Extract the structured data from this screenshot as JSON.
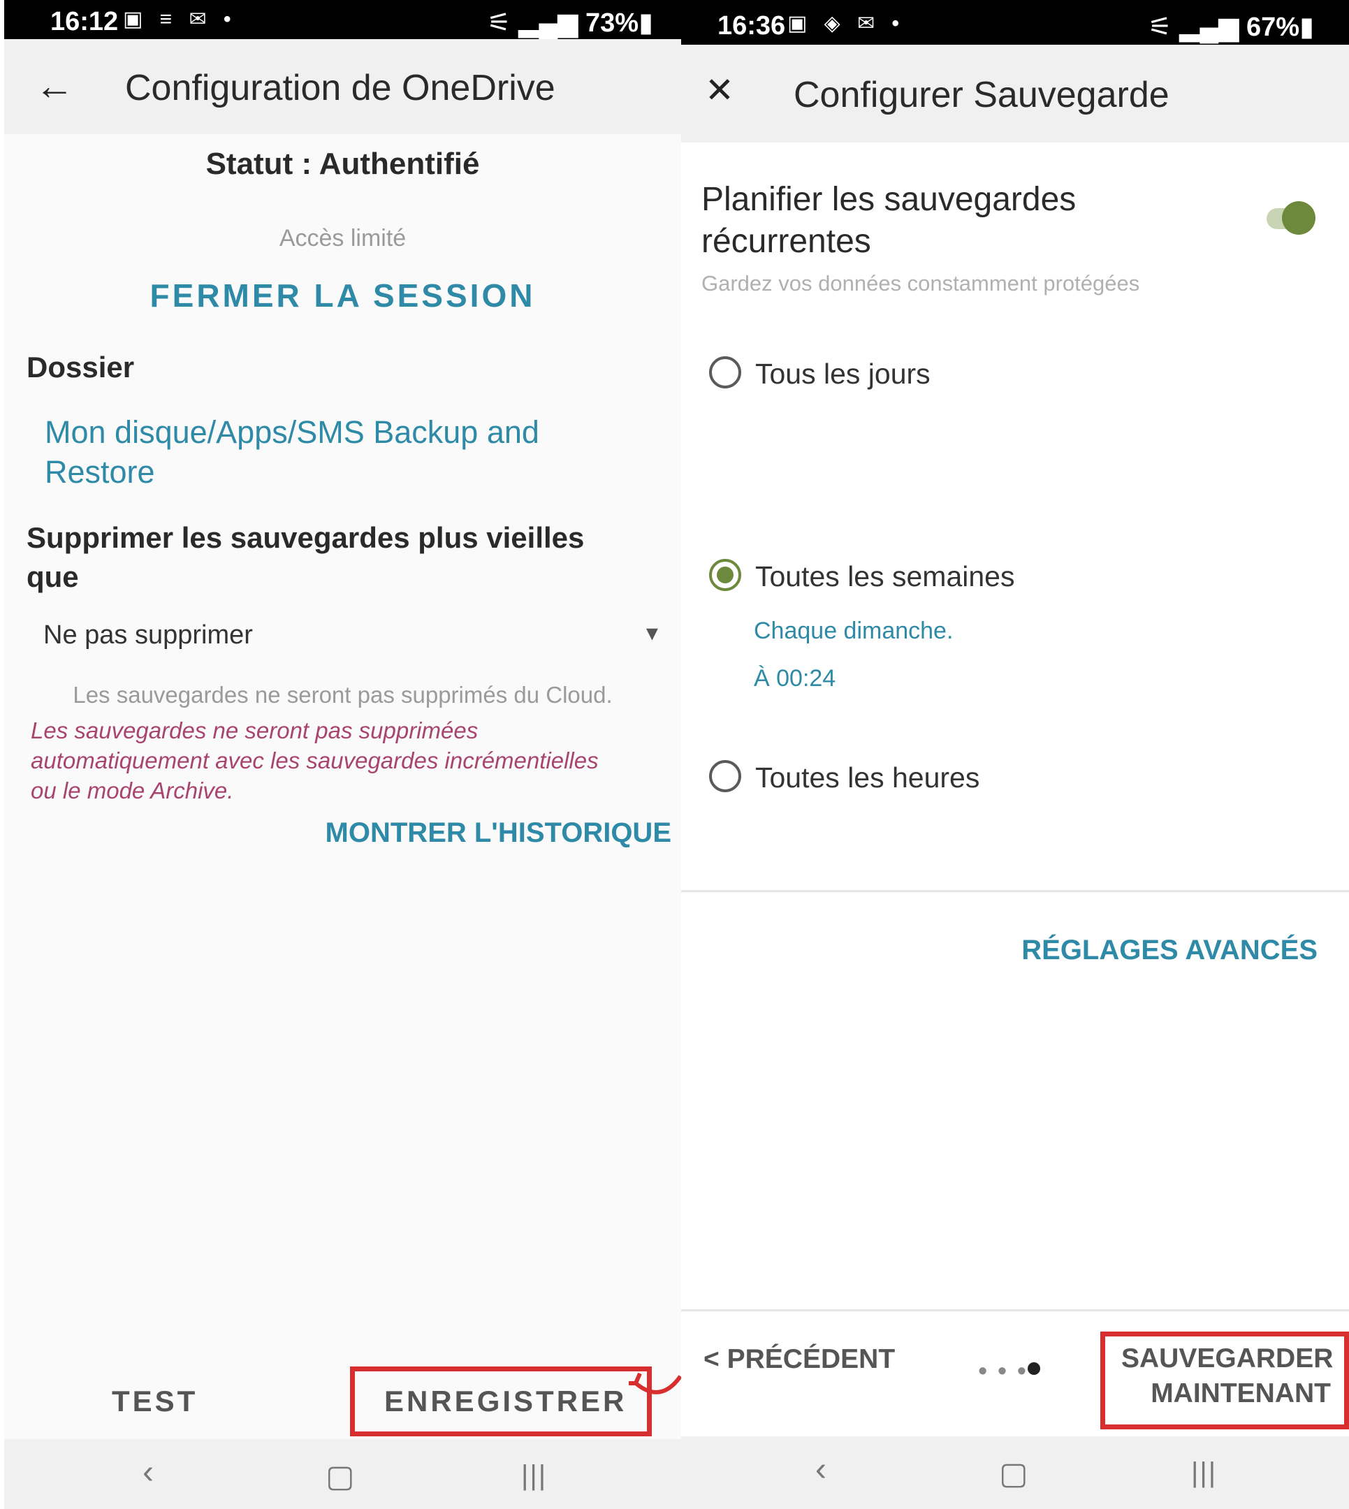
{
  "left": {
    "status_bar": {
      "time": "16:12",
      "icons": "▣ ≡ ✉ •",
      "signal": "⚟ ▂▄▆ 73%▮"
    },
    "appbar": {
      "back_icon": "←",
      "title": "Configuration de OneDrive"
    },
    "status": "Statut : Authentifié",
    "access": "Accès limité",
    "logout_label": "FERMER LA SESSION",
    "folder": {
      "heading": "Dossier",
      "path_line1": "Mon disque/Apps/SMS Backup and",
      "path_line2": "Restore"
    },
    "delete_older": {
      "heading_line1": "Supprimer les sauvegardes plus vieilles",
      "heading_line2": "que",
      "selected": "Ne pas supprimer",
      "caret": "▾"
    },
    "cloud_note": "Les sauvegardes ne seront pas supprimés du Cloud.",
    "warning_line1": "Les sauvegardes ne seront pas supprimées",
    "warning_line2": "automatiquement avec les sauvegardes incrémentielles",
    "warning_line3": "ou le mode Archive.",
    "history_label": "MONTRER L'HISTORIQUE",
    "footer": {
      "test_label": "TEST",
      "save_label": "ENREGISTRER"
    },
    "nav": {
      "back": "‹",
      "home": "▢",
      "recents": "|||"
    }
  },
  "right": {
    "status_bar": {
      "time": "16:36",
      "icons": "▣ ◈ ✉ •",
      "signal": "⚟ ▂▄▆ 67%▮"
    },
    "appbar": {
      "close_icon": "✕",
      "title": "Configurer Sauvegarde"
    },
    "schedule": {
      "title_line1": "Planifier les sauvegardes",
      "title_line2": "récurrentes",
      "subtitle": "Gardez vos données constamment protégées",
      "toggle_on": true
    },
    "options": [
      {
        "label": "Tous les jours",
        "checked": false
      },
      {
        "label": "Toutes les semaines",
        "checked": true
      },
      {
        "label": "Toutes les heures",
        "checked": false
      }
    ],
    "weekly_detail": {
      "day": "Chaque dimanche.",
      "time": "À 00:24"
    },
    "advanced_label": "RÉGLAGES AVANCÉS",
    "footer": {
      "prev_label": "< PRÉCÉDENT",
      "step_dots": "• • •",
      "backup_now_line1": "SAUVEGARDER",
      "backup_now_line2": "MAINTENANT"
    },
    "nav": {
      "back": "‹",
      "home": "▢",
      "recents": "|||"
    }
  },
  "colors": {
    "accent": "#2e8aa6",
    "warning": "#a8456e",
    "toggle": "#6d8a3c",
    "highlight": "#d72f2f"
  }
}
